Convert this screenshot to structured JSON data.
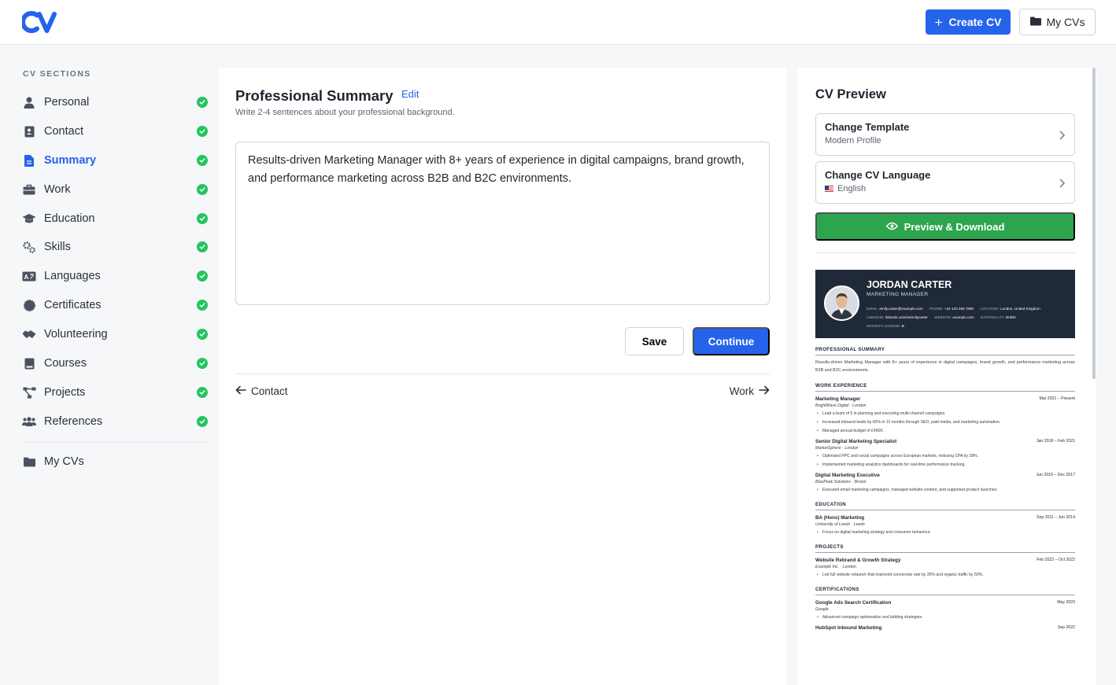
{
  "header": {
    "logo_text": "CV",
    "create_label": "Create CV",
    "mycvs_label": "My CVs"
  },
  "colors": {
    "primary": "#2563eb",
    "success": "#22c55e",
    "download": "#2da44e",
    "cv_header": "#1f2937"
  },
  "sidebar": {
    "heading": "CV SECTIONS",
    "items": [
      {
        "label": "Personal",
        "icon": "user-icon",
        "done": true
      },
      {
        "label": "Contact",
        "icon": "contact-card-icon",
        "done": true
      },
      {
        "label": "Summary",
        "icon": "document-icon",
        "done": true,
        "active": true
      },
      {
        "label": "Work",
        "icon": "briefcase-icon",
        "done": true
      },
      {
        "label": "Education",
        "icon": "graduation-cap-icon",
        "done": true
      },
      {
        "label": "Skills",
        "icon": "gears-icon",
        "done": true
      },
      {
        "label": "Languages",
        "icon": "language-icon",
        "done": true
      },
      {
        "label": "Certificates",
        "icon": "certificate-icon",
        "done": true
      },
      {
        "label": "Volunteering",
        "icon": "handshake-icon",
        "done": true
      },
      {
        "label": "Courses",
        "icon": "book-icon",
        "done": true
      },
      {
        "label": "Projects",
        "icon": "project-diagram-icon",
        "done": true
      },
      {
        "label": "References",
        "icon": "users-icon",
        "done": true
      }
    ],
    "mycvs_label": "My CVs"
  },
  "main": {
    "title": "Professional Summary",
    "edit_label": "Edit",
    "subtitle": "Write 2-4 sentences about your professional background.",
    "summary_text": "Results-driven Marketing Manager with 8+ years of experience in digital campaigns, brand growth, and performance marketing across B2B and B2C environments.",
    "save_label": "Save",
    "continue_label": "Continue",
    "prev_label": "Contact",
    "next_label": "Work"
  },
  "preview": {
    "title": "CV Preview",
    "template_title": "Change Template",
    "template_value": "Modern Profile",
    "language_title": "Change CV Language",
    "language_value": "English",
    "download_label": "Preview & Download"
  },
  "cv": {
    "name": "JORDAN CARTER",
    "role": "MARKETING MANAGER",
    "contact": {
      "email_k": "EMAIL:",
      "email": "emily.carter@example.com",
      "phone_k": "PHONE:",
      "phone": "+44 123 456 7890",
      "location_k": "LOCATION:",
      "location": "London, United Kingdom",
      "linkedin_k": "LINKEDIN:",
      "linkedin": "linkedin.com/in/emilycarter",
      "website_k": "WEBSITE:",
      "website": "example.com",
      "nationality_k": "NATIONALITY:",
      "nationality": "British",
      "license_k": "DRIVER'S LICENSE:",
      "license": "B"
    },
    "summary_heading": "PROFESSIONAL SUMMARY",
    "summary": "Results-driven Marketing Manager with 8+ years of experience in digital campaigns, brand growth, and performance marketing across B2B and B2C environments.",
    "work_heading": "WORK EXPERIENCE",
    "work": [
      {
        "title": "Marketing Manager",
        "dates": "Mar 2021 – Present",
        "org": "BrightWave Digital · London",
        "bullets": [
          "Lead a team of 5 in planning and executing multi-channel campaigns.",
          "Increased inbound leads by 42% in 12 months through SEO, paid media, and marketing automation.",
          "Managed annual budget of £450K."
        ]
      },
      {
        "title": "Senior Digital Marketing Specialist",
        "dates": "Jan 2018 – Feb 2021",
        "org": "MarketSphere · London",
        "bullets": [
          "Optimised PPC and social campaigns across European markets, reducing CPA by 28%.",
          "Implemented marketing analytics dashboards for real-time performance tracking."
        ]
      },
      {
        "title": "Digital Marketing Executive",
        "dates": "Jun 2015 – Dec 2017",
        "org": "BluePeak Solutions · Bristol",
        "bullets": [
          "Executed email marketing campaigns, managed website content, and supported product launches."
        ]
      }
    ],
    "education_heading": "EDUCATION",
    "education": [
      {
        "title": "BA (Hons) Marketing",
        "dates": "Sep 2011 – Jun 2014",
        "org": "University of Leeds · Leeds",
        "bullets": [
          "Focus on digital marketing strategy and consumer behaviour."
        ]
      }
    ],
    "projects_heading": "PROJECTS",
    "projects": [
      {
        "title": "Website Rebrand & Growth Strategy",
        "dates": "Feb 2022 – Oct 2022",
        "org": "Example Inc. · London",
        "bullets": [
          "Led full website relaunch that improved conversion rate by 35% and organic traffic by 50%."
        ]
      }
    ],
    "certifications_heading": "CERTIFICATIONS",
    "certifications": [
      {
        "title": "Google Ads Search Certification",
        "dates": "May 2023",
        "org": "Google",
        "bullets": [
          "Advanced campaign optimisation and bidding strategies."
        ]
      },
      {
        "title": "HubSpot Inbound Marketing",
        "dates": "Sep 2022",
        "org": "",
        "bullets": []
      }
    ]
  }
}
